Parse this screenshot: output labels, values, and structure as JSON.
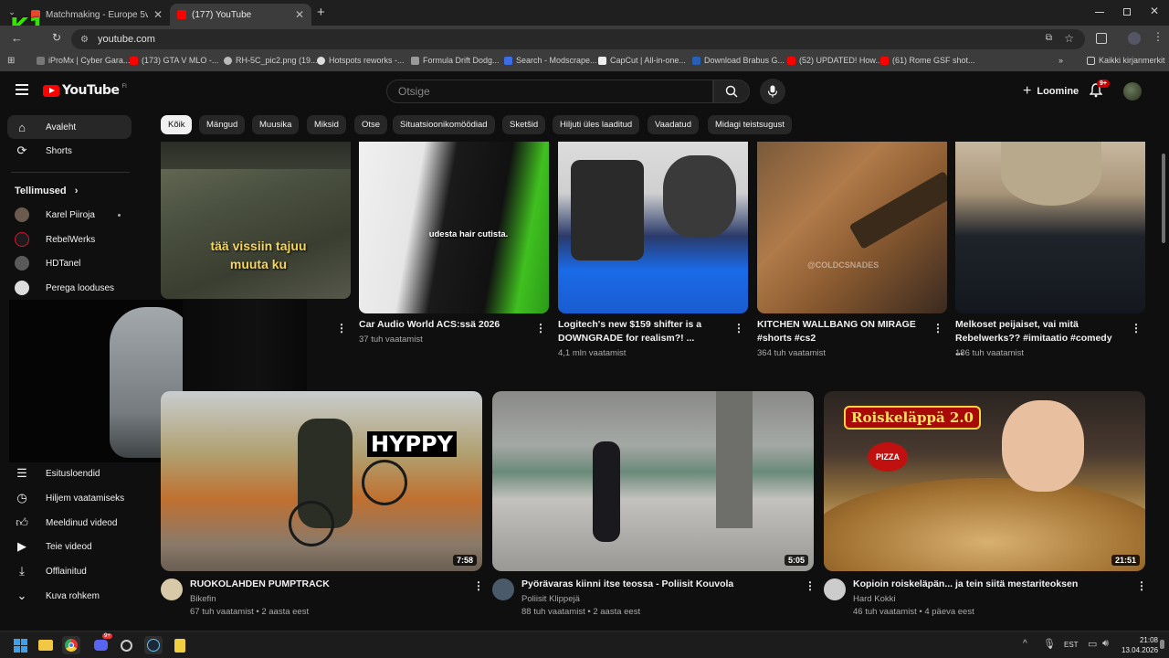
{
  "browser": {
    "tabs": [
      {
        "title": "Matchmaking - Europe 5v5 Qu",
        "active": false
      },
      {
        "title": "(177) YouTube",
        "active": true
      }
    ],
    "url": "youtube.com",
    "bookmarks": [
      "iProMx | Cyber Gara...",
      "(173) GTA V MLO -...",
      "RH-5C_pic2.png (19...",
      "Hotspots reworks -...",
      "Formula Drift Dodg...",
      "Search - Modscrape...",
      "CapCut | All-in-one...",
      "Download Brabus G...",
      "(52) UPDATED! How...",
      "(61) Rome GSF shot..."
    ],
    "all_bookmarks": "Kaikki kirjanmerkit"
  },
  "overlay": {
    "logo_text": "K1"
  },
  "header": {
    "logo": "YouTube",
    "region": "FI",
    "search_placeholder": "Otsige",
    "create_label": "Loomine",
    "notif_count": "9+"
  },
  "sidebar": {
    "items": [
      {
        "label": "Avaleht",
        "icon": "home-icon"
      },
      {
        "label": "Shorts",
        "icon": "shorts-icon"
      }
    ],
    "subs_header": "Tellimused",
    "subs": [
      {
        "name": "Karel Piiroja",
        "color": "#6b5b4f"
      },
      {
        "name": "RebelWerks",
        "color": "#1b1b1b"
      },
      {
        "name": "HDTanel",
        "color": "#5a5a5a"
      },
      {
        "name": "Perega looduses",
        "color": "#dddddd"
      }
    ],
    "you_items": [
      {
        "label": "Esitusloendid",
        "icon": "playlist-icon"
      },
      {
        "label": "Hiljem vaatamiseks",
        "icon": "clock-icon"
      },
      {
        "label": "Meeldinud videod",
        "icon": "thumb-up-icon"
      },
      {
        "label": "Teie videod",
        "icon": "video-icon"
      },
      {
        "label": "Offlainitud",
        "icon": "download-icon"
      },
      {
        "label": "Kuva rohkem",
        "icon": "chevron-down-icon"
      }
    ]
  },
  "chips": [
    "Kõik",
    "Mängud",
    "Muusika",
    "Miksid",
    "Otse",
    "Situatsioonikomöödiad",
    "Sketšid",
    "Hiljuti üles laaditud",
    "Vaadatud",
    "Midagi teistsugust"
  ],
  "shorts": [
    {
      "title": "",
      "views": "",
      "caption": "tää vissiin tajuu muuta ku"
    },
    {
      "title": "Car Audio World ACS:ssä 2026",
      "views": "37 tuh vaatamist",
      "caption": "udesta hair cutista."
    },
    {
      "title": "Logitech's new $159 shifter is a DOWNGRADE for realism?! ...",
      "views": "4,1 mln vaatamist",
      "caption": ""
    },
    {
      "title": "KITCHEN WALLBANG ON MIRAGE #shorts #cs2",
      "views": "364 tuh vaatamist",
      "caption": "@COLDCSNADES"
    },
    {
      "title": "Melkoset peijaiset, vai mitä Rebelwerks?? #imitaatio #comedy ...",
      "views": "186 tuh vaatamist",
      "caption": ""
    }
  ],
  "videos": [
    {
      "title": "RUOKOLAHDEN PUMPTRACK",
      "channel": "Bikefin",
      "views": "67 tuh vaatamist",
      "age": "2 aasta eest",
      "duration": "7:58",
      "overlay": "HYPPY",
      "avatar": "#d8c9a8"
    },
    {
      "title": "Pyörävaras kiinni itse teossa - Poliisit Kouvola",
      "channel": "Poliisit Klippejä",
      "views": "88 tuh vaatamist",
      "age": "2 aasta eest",
      "duration": "5:05",
      "overlay": "",
      "avatar": "#4a5a6a"
    },
    {
      "title": "Kopioin roiskeläpän... ja tein siitä mestariteoksen",
      "channel": "Hard Kokki",
      "views": "46 tuh vaatamist",
      "age": "4 päeva eest",
      "duration": "21:51",
      "overlay": "Roiskeläppä 2.0",
      "overlay2": "PIZZA",
      "avatar": "#ccc"
    }
  ],
  "meta_sep": "•",
  "taskbar": {
    "time": "21:08",
    "date": "13.04.2026",
    "lang": "EST",
    "discord_badge": "9+"
  }
}
